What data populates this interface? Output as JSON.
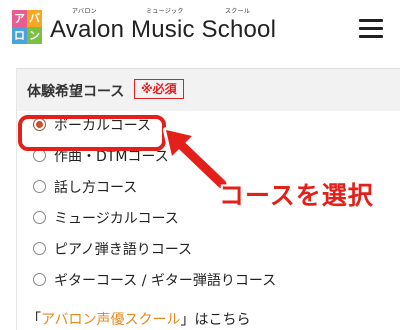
{
  "header": {
    "logo_tiles": [
      "ア",
      "バ",
      "ロ",
      "ン"
    ],
    "ruby": [
      "アバロン",
      "ミュージック",
      "スクール"
    ],
    "brand_name": "Avalon Music School",
    "menu_icon": "hamburger-menu-icon"
  },
  "form": {
    "field_label": "体験希望コース",
    "required_badge": "※必須",
    "options": [
      {
        "label": "ボーカルコース",
        "selected": true
      },
      {
        "label": "作曲・DTMコース",
        "selected": false
      },
      {
        "label": "話し方コース",
        "selected": false
      },
      {
        "label": "ミュージカルコース",
        "selected": false
      },
      {
        "label": "ピアノ弾き語りコース",
        "selected": false
      },
      {
        "label": "ギターコース / ギター弾語りコース",
        "selected": false
      }
    ],
    "footer": {
      "open_bracket": "「",
      "link_text": "アバロン声優スクール",
      "close_text": "」はこちら"
    }
  },
  "annotation": {
    "callout_text": "コースを選択"
  },
  "colors": {
    "accent_red": "#e4201a",
    "link_orange": "#e6891b",
    "radio_selected": "#c8502a"
  }
}
